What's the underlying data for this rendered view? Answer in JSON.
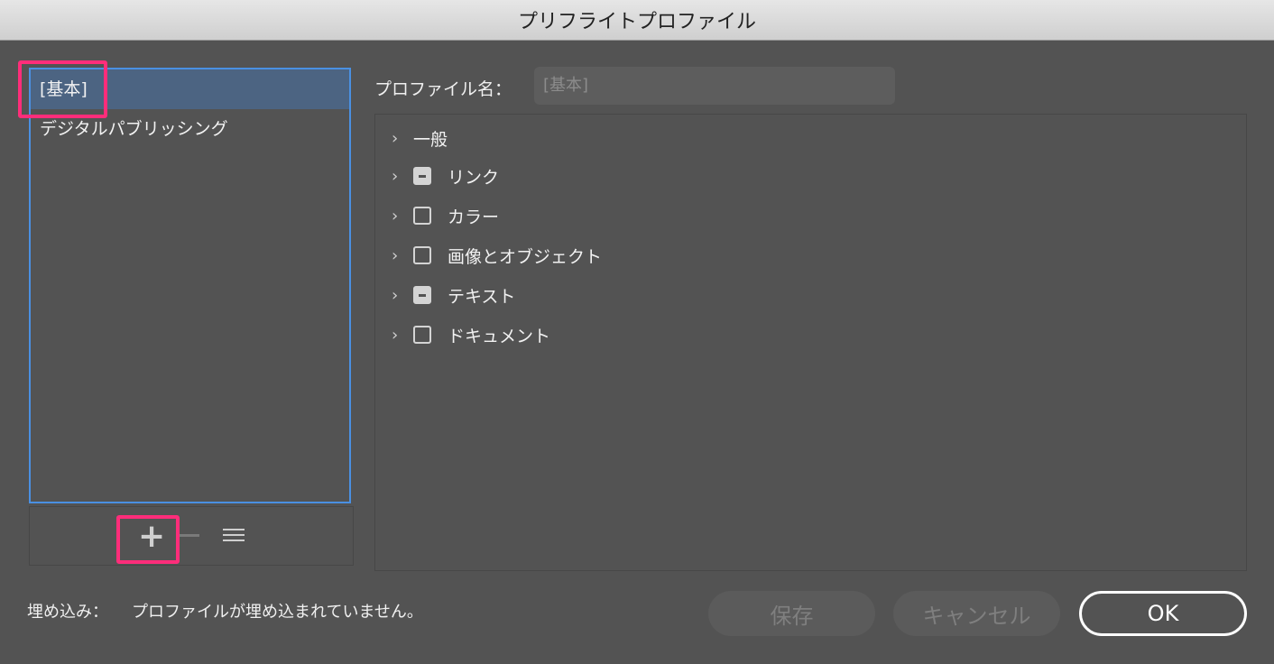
{
  "window": {
    "title": "プリフライトプロファイル"
  },
  "profile_list": {
    "items": [
      {
        "label": "[基本]",
        "selected": true
      },
      {
        "label": "デジタルパブリッシング",
        "selected": false
      }
    ]
  },
  "list_toolbar": {
    "add_icon": "plus-icon",
    "remove_icon": "minus-icon",
    "menu_icon": "menu-icon"
  },
  "profile_name": {
    "label": "プロファイル名：",
    "value": "[基本]"
  },
  "categories": [
    {
      "label": "一般",
      "checkbox": "none"
    },
    {
      "label": "リンク",
      "checkbox": "mixed"
    },
    {
      "label": "カラー",
      "checkbox": "unchecked"
    },
    {
      "label": "画像とオブジェクト",
      "checkbox": "unchecked"
    },
    {
      "label": "テキスト",
      "checkbox": "mixed"
    },
    {
      "label": "ドキュメント",
      "checkbox": "unchecked"
    }
  ],
  "embed": {
    "label": "埋め込み：",
    "value": "プロファイルが埋め込まれていません。"
  },
  "buttons": {
    "save": "保存",
    "cancel": "キャンセル",
    "ok": "OK"
  },
  "colors": {
    "selection": "#4c6482",
    "focus": "#4a90e2",
    "highlight": "#ff2d7a"
  }
}
